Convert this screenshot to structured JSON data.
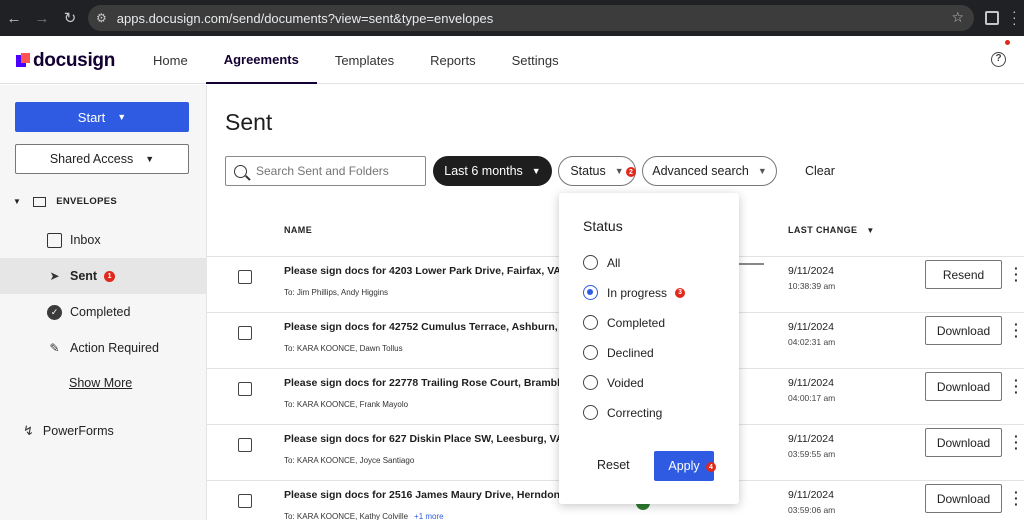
{
  "browser": {
    "url": "apps.docusign.com/send/documents?view=sent&type=envelopes"
  },
  "header": {
    "logo": "docusign",
    "tabs": [
      "Home",
      "Agreements",
      "Templates",
      "Reports",
      "Settings"
    ],
    "active_tab": "Agreements"
  },
  "sidebar": {
    "start_label": "Start",
    "shared_access_label": "Shared Access",
    "envelopes_label": "ENVELOPES",
    "items": [
      {
        "label": "Inbox"
      },
      {
        "label": "Sent",
        "badge": "1"
      },
      {
        "label": "Completed"
      },
      {
        "label": "Action Required"
      }
    ],
    "show_more": "Show More",
    "powerforms": "PowerForms"
  },
  "main": {
    "title": "Sent",
    "search_placeholder": "Search Sent and Folders",
    "filter_date": "Last 6 months",
    "filter_status": "Status",
    "status_badge": "2",
    "advanced_search": "Advanced search",
    "clear": "Clear",
    "col_name": "NAME",
    "col_last_change": "LAST CHANGE"
  },
  "rows": [
    {
      "subject": "Please sign docs for 4203 Lower Park Drive, Fairfax, VA, 22",
      "recipients": "To: Jim Phillips, Andy Higgins",
      "date": "9/11/2024",
      "time": "10:38:39 am",
      "action": "Resend"
    },
    {
      "subject": "Please sign docs for 42752 Cumulus Terrace, Ashburn, VA,",
      "recipients": "To: KARA KOONCE, Dawn Tollus",
      "date": "9/11/2024",
      "time": "04:02:31 am",
      "action": "Download"
    },
    {
      "subject": "Please sign docs for 22778 Trailing Rose Court, Brambleton",
      "recipients": "To: KARA KOONCE, Frank Mayolo",
      "date": "9/11/2024",
      "time": "04:00:17 am",
      "action": "Download"
    },
    {
      "subject": "Please sign docs for 627 Diskin Place SW, Leesburg, VA, 20",
      "recipients": "To: KARA KOONCE, Joyce Santiago",
      "date": "9/11/2024",
      "time": "03:59:55 am",
      "action": "Download"
    },
    {
      "subject": "Please sign docs for 2516 James Maury Drive, Herndon, VA",
      "recipients": "To: KARA KOONCE, Kathy Colville",
      "more": "+1 more",
      "date": "9/11/2024",
      "time": "03:59:06 am",
      "action": "Download"
    }
  ],
  "status_panel": {
    "title": "Status",
    "options": [
      "All",
      "In progress",
      "Completed",
      "Declined",
      "Voided",
      "Correcting"
    ],
    "selected": "In progress",
    "selected_badge": "3",
    "reset": "Reset",
    "apply": "Apply",
    "apply_badge": "4"
  },
  "colors": {
    "primary_blue": "#2f5be3",
    "badge_red": "#e0281c",
    "dark_pill": "#1e1e1e",
    "brand_purple": "#4c00ff"
  }
}
